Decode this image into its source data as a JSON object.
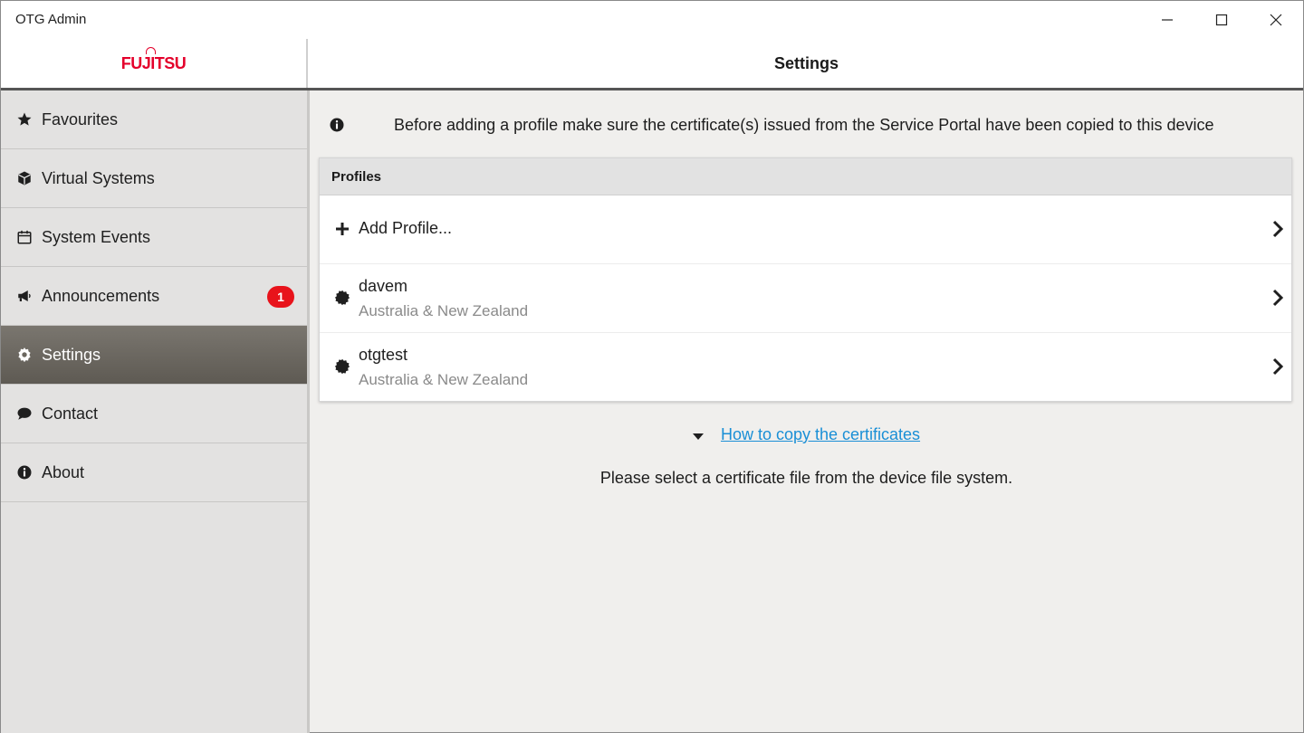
{
  "window": {
    "title": "OTG Admin"
  },
  "brand": {
    "logo_text": "FUJITSU",
    "logo_color": "#e4002b"
  },
  "header": {
    "page_title": "Settings"
  },
  "sidebar": {
    "items": [
      {
        "label": "Favourites",
        "icon": "star-icon"
      },
      {
        "label": "Virtual Systems",
        "icon": "cube-icon"
      },
      {
        "label": "System Events",
        "icon": "calendar-icon"
      },
      {
        "label": "Announcements",
        "icon": "megaphone-icon",
        "badge": "1"
      },
      {
        "label": "Settings",
        "icon": "gear-icon",
        "active": true
      },
      {
        "label": "Contact",
        "icon": "speech-bubble-icon"
      },
      {
        "label": "About",
        "icon": "info-icon"
      }
    ]
  },
  "main": {
    "notice": "Before adding a profile make sure the certificate(s) issued from the Service Portal have been copied to this device",
    "profiles": {
      "header": "Profiles",
      "add_label": "Add Profile...",
      "items": [
        {
          "name": "davem",
          "region": "Australia & New Zealand"
        },
        {
          "name": "otgtest",
          "region": "Australia & New Zealand"
        }
      ]
    },
    "howto_link": "How to copy the certificates",
    "select_message": "Please select a certificate file from the device file system."
  },
  "colors": {
    "accent_link": "#1a8fd6",
    "badge": "#e8131b",
    "active_nav": "#6b675f"
  }
}
